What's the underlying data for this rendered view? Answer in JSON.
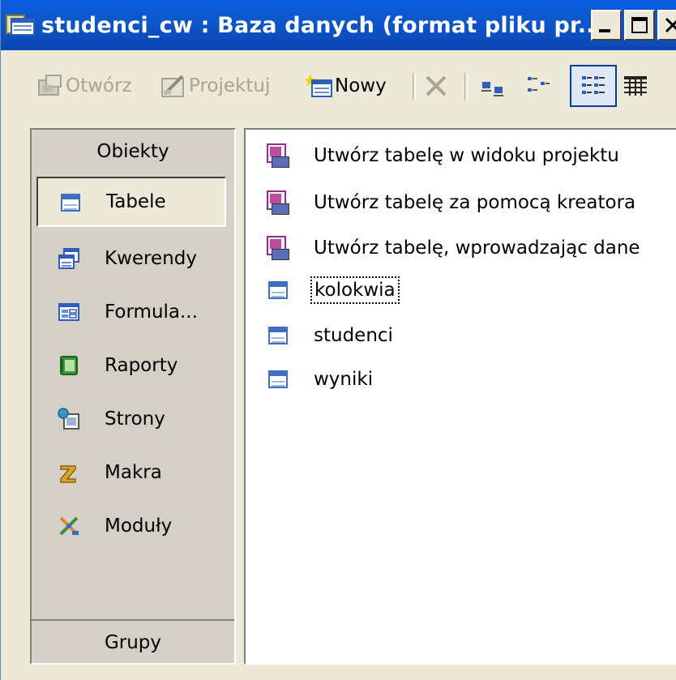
{
  "window": {
    "title": "studenci_cw : Baza danych (format pliku pr...",
    "controls": [
      "minimize",
      "maximize",
      "close"
    ]
  },
  "toolbar": {
    "open_label": "Otwórz",
    "design_label": "Projektuj",
    "new_label": "Nowy",
    "buttons_enabled": {
      "open": false,
      "design": false,
      "new": true,
      "delete": false
    }
  },
  "objects_panel": {
    "header": "Obiekty",
    "items": [
      {
        "label": "Tabele",
        "icon": "table-icon",
        "selected": true
      },
      {
        "label": "Kwerendy",
        "icon": "query-icon",
        "selected": false
      },
      {
        "label": "Formula...",
        "icon": "form-icon",
        "selected": false
      },
      {
        "label": "Raporty",
        "icon": "report-icon",
        "selected": false
      },
      {
        "label": "Strony",
        "icon": "page-icon",
        "selected": false
      },
      {
        "label": "Makra",
        "icon": "macro-icon",
        "selected": false
      },
      {
        "label": "Moduły",
        "icon": "module-icon",
        "selected": false
      }
    ],
    "footer": "Grupy"
  },
  "list": {
    "items": [
      {
        "label": "Utwórz tabelę w widoku projektu",
        "icon": "wizard-icon"
      },
      {
        "label": "Utwórz tabelę za pomocą kreatora",
        "icon": "wizard-icon"
      },
      {
        "label": "Utwórz tabelę, wprowadzając dane",
        "icon": "wizard-icon"
      },
      {
        "label": "kolokwia",
        "icon": "table-icon",
        "focused": true
      },
      {
        "label": "studenci",
        "icon": "table-icon"
      },
      {
        "label": "wyniki",
        "icon": "table-icon"
      }
    ]
  },
  "colors": {
    "titlebar": "#0b52c8",
    "face": "#ece9d8",
    "panel": "#d4d0c8",
    "list_bg": "#ffffff",
    "disabled_text": "#a8a495"
  }
}
